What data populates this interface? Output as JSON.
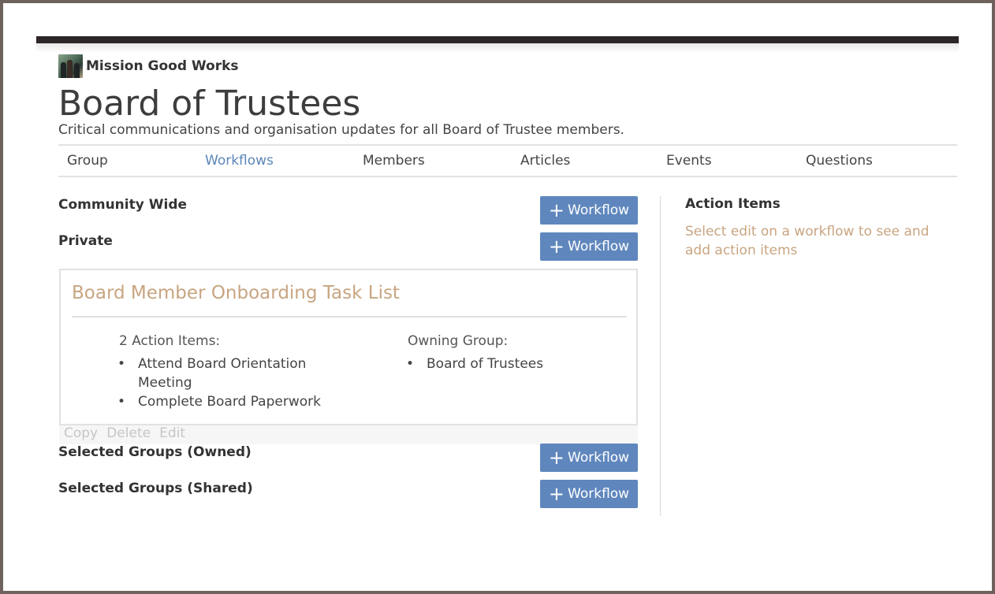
{
  "brand": {
    "name": "Mission Good Works",
    "logo_icon": "group-photo-logo"
  },
  "page": {
    "title": "Board of Trustees",
    "subtitle": "Critical communications and organisation updates for all Board of Trustee members."
  },
  "nav": {
    "tabs": [
      {
        "label": "Group",
        "active": false
      },
      {
        "label": "Workflows",
        "active": true
      },
      {
        "label": "Members",
        "active": false
      },
      {
        "label": "Articles",
        "active": false
      },
      {
        "label": "Events",
        "active": false
      },
      {
        "label": "Questions",
        "active": false
      }
    ]
  },
  "sections": {
    "community_wide": {
      "label": "Community Wide",
      "button": "Workflow"
    },
    "private": {
      "label": "Private",
      "button": "Workflow"
    },
    "owned": {
      "label": "Selected Groups (Owned)",
      "button": "Workflow"
    },
    "shared": {
      "label": "Selected Groups (Shared)",
      "button": "Workflow"
    }
  },
  "workflow_card": {
    "title": "Board Member Onboarding Task List",
    "action_items_heading": "2 Action Items:",
    "action_items": [
      "Attend Board Orientation Meeting",
      "Complete Board Paperwork"
    ],
    "owning_group_heading": "Owning Group:",
    "owning_groups": [
      "Board of Trustees"
    ],
    "actions": {
      "copy": "Copy",
      "delete": "Delete",
      "edit": "Edit"
    }
  },
  "action_panel": {
    "title": "Action Items",
    "hint": "Select edit on a workflow to see and add action items"
  },
  "colors": {
    "accent_blue": "#5f87bd",
    "tan_text": "#c8a581",
    "active_tab": "#5b86ba",
    "top_bar": "#2d2626"
  }
}
